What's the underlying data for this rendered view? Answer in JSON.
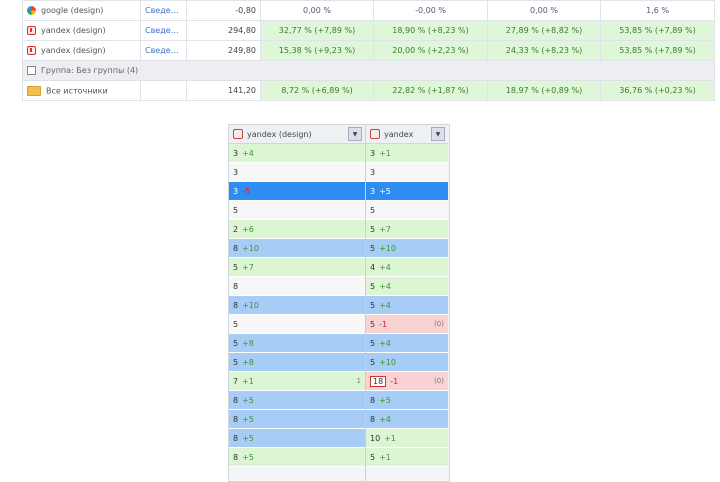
{
  "top_rows": [
    {
      "type": "data",
      "icon": "google-icon",
      "name": "google (design)",
      "link": "Сведения",
      "num": "-0,80",
      "c1": "0,00 %",
      "c2": "-0,00 %",
      "c3": "0,00 %",
      "c4": "1,6 %",
      "green": false
    },
    {
      "type": "data",
      "icon": "yandex-icon",
      "name": "yandex (design)",
      "link": "Сведения",
      "num": "294,80",
      "c1": "32,77 % (+7,89 %)",
      "c2": "18,90 % (+8,23 %)",
      "c3": "27,89 % (+8,82 %)",
      "c4": "53,85 % (+7,89 %)",
      "green": true
    },
    {
      "type": "data",
      "icon": "yandex-icon",
      "name": "yandex (design)",
      "link": "Сведения",
      "num": "249,80",
      "c1": "15,38 % (+9,23 %)",
      "c2": "20,00 % (+2,23 %)",
      "c3": "24,33 % (+8,23 %)",
      "c4": "53,85 % (+7,89 %)",
      "green": true
    },
    {
      "type": "group",
      "label": "Группа: Без группы (4)"
    },
    {
      "type": "data",
      "icon": "folder-icon",
      "name": "Все источники",
      "link": "",
      "num": "141,20",
      "c1": "8,72 % (+6,89 %)",
      "c2": "22,82 % (+1,87 %)",
      "c3": "18,97 % (+0,89 %)",
      "c4": "36,76 % (+0,23 %)",
      "green": true
    }
  ],
  "panel": {
    "col_a_header": "yandex (design)",
    "col_b_header": "yandex",
    "rows_a": [
      {
        "val": "3",
        "delta": "+4",
        "style": "green",
        "tail": ""
      },
      {
        "val": "3",
        "delta": "",
        "style": "white",
        "tail": ""
      },
      {
        "val": "3",
        "delta": "-5",
        "style": "sel",
        "tail": ""
      },
      {
        "val": "5",
        "delta": "",
        "style": "white",
        "tail": ""
      },
      {
        "val": "2",
        "delta": "+6",
        "style": "green",
        "tail": ""
      },
      {
        "val": "8",
        "delta": "+10",
        "style": "blue",
        "tail": ""
      },
      {
        "val": "5",
        "delta": "+7",
        "style": "green",
        "tail": ""
      },
      {
        "val": "8",
        "delta": "",
        "style": "white",
        "tail": ""
      },
      {
        "val": "8",
        "delta": "+10",
        "style": "blue",
        "tail": ""
      },
      {
        "val": "5",
        "delta": "",
        "style": "white",
        "tail": ""
      },
      {
        "val": "5",
        "delta": "+8",
        "style": "blue",
        "tail": ""
      },
      {
        "val": "5",
        "delta": "+8",
        "style": "blue",
        "tail": ""
      },
      {
        "val": "7",
        "delta": "+1",
        "style": "green",
        "tail": "1"
      },
      {
        "val": "8",
        "delta": "+5",
        "style": "blue",
        "tail": ""
      },
      {
        "val": "8",
        "delta": "+5",
        "style": "blue",
        "tail": ""
      },
      {
        "val": "8",
        "delta": "+5",
        "style": "blue",
        "tail": ""
      },
      {
        "val": "8",
        "delta": "+5",
        "style": "green",
        "tail": ""
      }
    ],
    "rows_b": [
      {
        "val": "3",
        "delta": "+1",
        "style": "green",
        "tail": ""
      },
      {
        "val": "3",
        "delta": "",
        "style": "white",
        "tail": ""
      },
      {
        "val": "3",
        "delta": "+5",
        "style": "sel",
        "tail": ""
      },
      {
        "val": "5",
        "delta": "",
        "style": "white",
        "tail": ""
      },
      {
        "val": "5",
        "delta": "+7",
        "style": "green",
        "tail": ""
      },
      {
        "val": "5",
        "delta": "+10",
        "style": "blue",
        "tail": ""
      },
      {
        "val": "4",
        "delta": "+4",
        "style": "green",
        "tail": ""
      },
      {
        "val": "5",
        "delta": "+4",
        "style": "green",
        "tail": ""
      },
      {
        "val": "5",
        "delta": "+4",
        "style": "blue",
        "tail": ""
      },
      {
        "val": "5",
        "delta": "-1",
        "style": "red",
        "tail": "(0)"
      },
      {
        "val": "5",
        "delta": "+4",
        "style": "blue",
        "tail": ""
      },
      {
        "val": "5",
        "delta": "+10",
        "style": "blue",
        "tail": ""
      },
      {
        "val": "18",
        "delta": "-1",
        "style": "redbox",
        "tail": "(0)"
      },
      {
        "val": "8",
        "delta": "+5",
        "style": "blue",
        "tail": ""
      },
      {
        "val": "8",
        "delta": "+4",
        "style": "blue",
        "tail": ""
      },
      {
        "val": "10",
        "delta": "+1",
        "style": "green",
        "tail": ""
      },
      {
        "val": "5",
        "delta": "+1",
        "style": "green",
        "tail": ""
      }
    ]
  }
}
